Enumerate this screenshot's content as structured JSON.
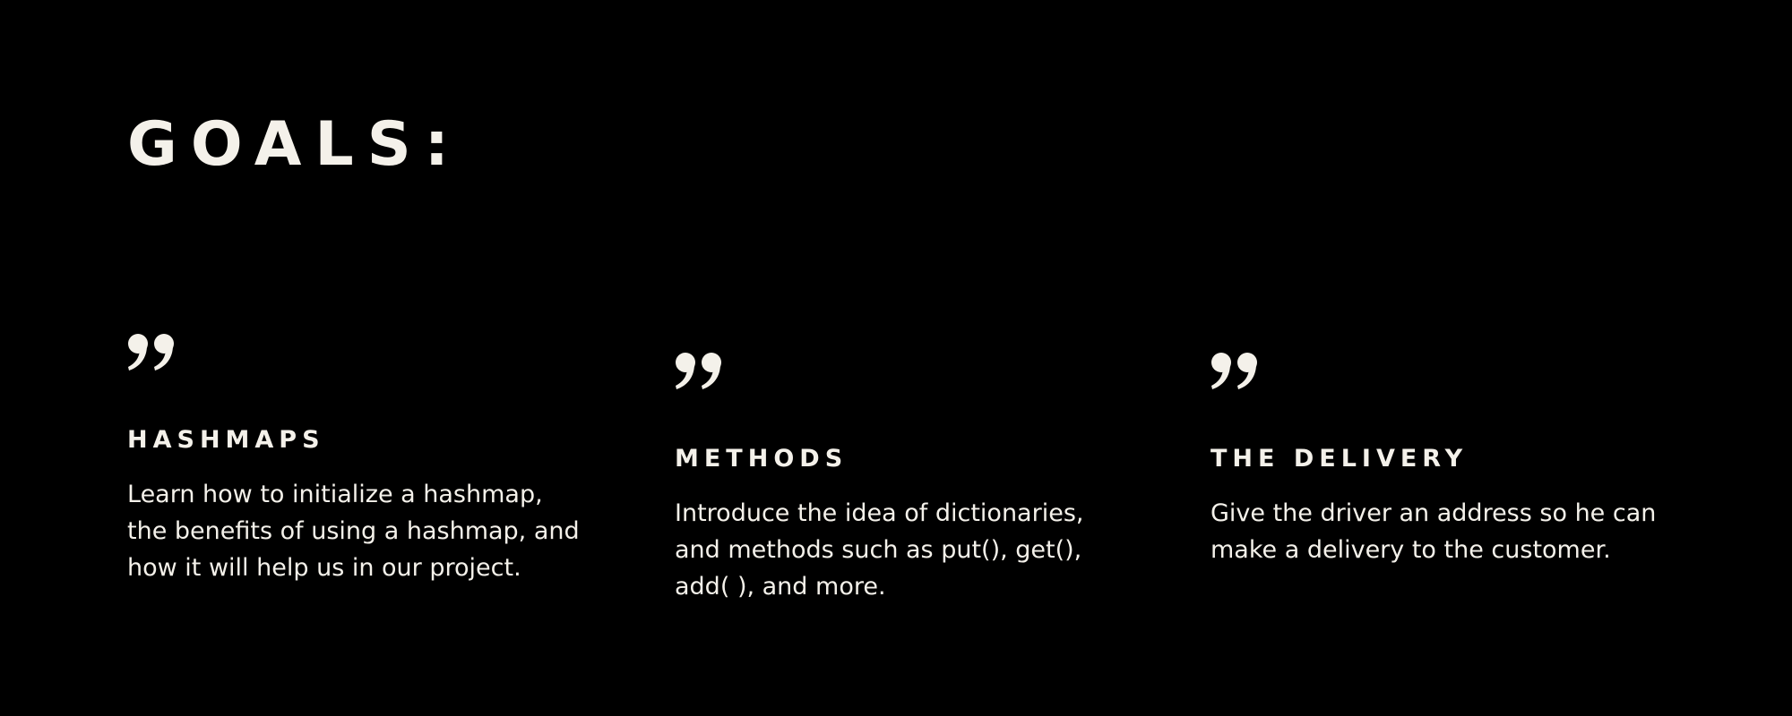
{
  "slide": {
    "title": "GOALS:",
    "background_color": "#000000",
    "text_color": "#f4f1ea"
  },
  "goals": [
    {
      "icon": "quote-icon",
      "heading": "HASHMAPS",
      "lines": [
        "Learn how to initialize a hashmap,",
        "the benefits of using a hashmap, and",
        "how it will help us in our project."
      ]
    },
    {
      "icon": "quote-icon",
      "heading": "METHODS",
      "lines": [
        "Introduce the idea of dictionaries,",
        "and methods such as put(), get(),",
        "add( ), and more."
      ]
    },
    {
      "icon": "quote-icon",
      "heading": "THE DELIVERY",
      "lines": [
        "Give the driver an address so he can",
        "make a delivery to the customer."
      ]
    }
  ]
}
